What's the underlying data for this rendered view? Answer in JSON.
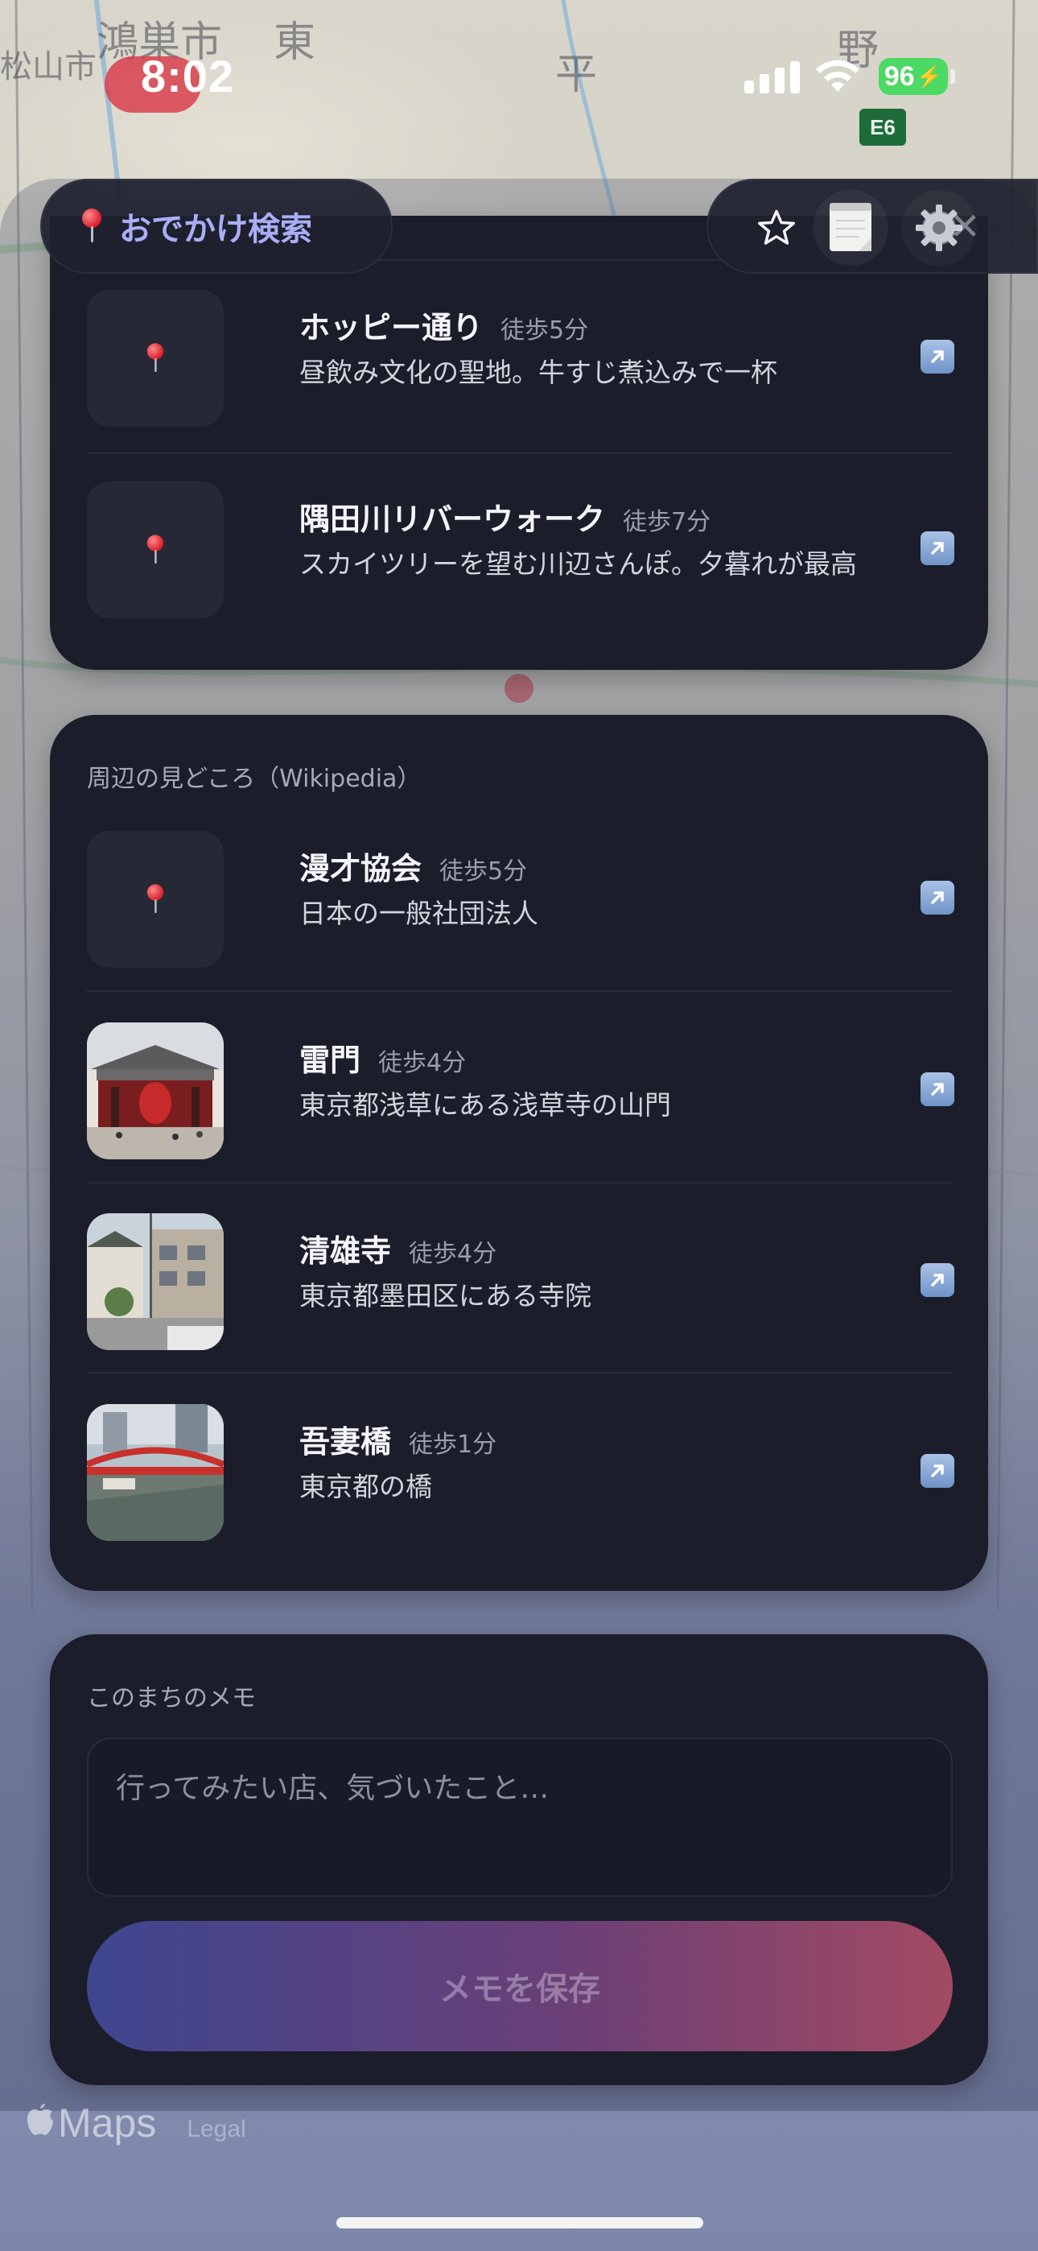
{
  "status_bar": {
    "time": "8:02",
    "battery": "96",
    "map_badge": "E6"
  },
  "map": {
    "labels": [
      "鴻巣市",
      "東",
      "平",
      "野",
      "松山市"
    ]
  },
  "header": {
    "title": "おでかけ検索",
    "icons": [
      "pin-icon",
      "star-icon",
      "memo-icon",
      "gear-icon",
      "close-icon"
    ]
  },
  "spots": [
    {
      "name": "ホッピー通り",
      "walk": "徒歩5分",
      "desc": "昼飲み文化の聖地。牛すじ煮込みで一杯"
    },
    {
      "name": "隅田川リバーウォーク",
      "walk": "徒歩7分",
      "desc": "スカイツリーを望む川辺さんぽ。夕暮れが最高"
    }
  ],
  "wiki": {
    "label": "周辺の見どころ（Wikipedia）",
    "items": [
      {
        "name": "漫才協会",
        "walk": "徒歩5分",
        "desc": "日本の一般社団法人",
        "thumb": "pin-icon"
      },
      {
        "name": "雷門",
        "walk": "徒歩4分",
        "desc": "東京都浅草にある浅草寺の山門",
        "thumb": "temple-gate-photo"
      },
      {
        "name": "清雄寺",
        "walk": "徒歩4分",
        "desc": "東京都墨田区にある寺院",
        "thumb": "temple-street-photo"
      },
      {
        "name": "吾妻橋",
        "walk": "徒歩1分",
        "desc": "東京都の橋",
        "thumb": "red-bridge-photo"
      }
    ]
  },
  "memo": {
    "label": "このまちのメモ",
    "placeholder": "行ってみたい店、気づいたこと…",
    "save_label": "メモを保存"
  },
  "footer": {
    "maps_logo": "Maps",
    "legal": "Legal"
  },
  "colors": {
    "card_bg": "#1c1d2b",
    "title_accent": "#a9aef6",
    "save_gradient_start": "#3e4690",
    "save_gradient_end": "#a24a62"
  }
}
